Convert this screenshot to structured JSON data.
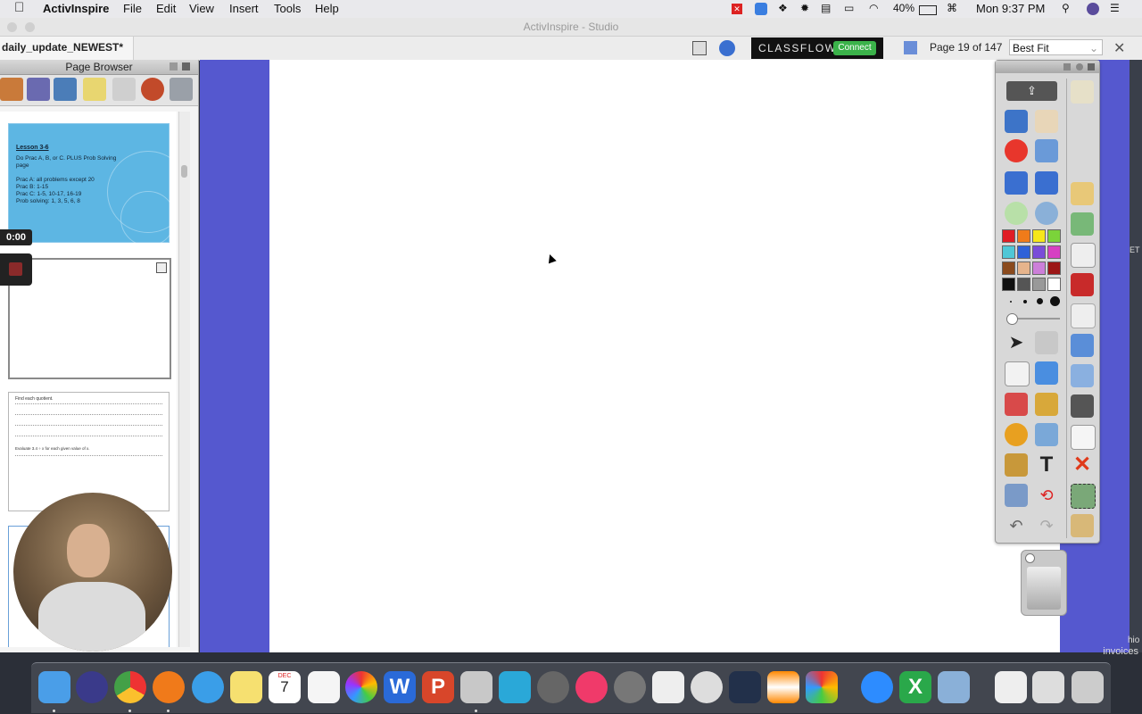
{
  "menubar": {
    "app_name": "ActivInspire",
    "menus": [
      "File",
      "Edit",
      "View",
      "Insert",
      "Tools",
      "Help"
    ],
    "battery": "40%",
    "clock": "Mon 9:37 PM"
  },
  "window": {
    "title": "ActivInspire - Studio"
  },
  "toolbar": {
    "doc_tab": "daily_update_NEWEST*",
    "classflow_label": "CLASSFLOW",
    "connect_label": "Connect",
    "page_info": "Page 19 of 147",
    "zoom_value": "Best Fit"
  },
  "page_browser": {
    "title": "Page Browser",
    "thumb1": {
      "heading": "Lesson 3-6",
      "line1": "Do Prac A, B, or C. PLUS Prob Solving",
      "line2": "page",
      "line3": "Prac A: all problems except 20",
      "line4": "Prac B: 1-15",
      "line5": "Prac C: 1-5, 10-17, 16-19",
      "line6": "Prob solving: 1, 3, 5, 6, 8"
    },
    "thumb3": {
      "heading": "Find each quotient.",
      "subheading": "Evaluate 3.4 ÷ x for each given value of x."
    }
  },
  "recording": {
    "timer": "0:00"
  },
  "desktop": {
    "invoices_label": "invoices",
    "edge_label_1": "ET",
    "edge_label_2": "hio"
  },
  "dock": {
    "calendar_month": "DEC",
    "calendar_day": "7"
  },
  "colors": {
    "canvas_border_blue": "#5558cf",
    "classflow_green": "#3bb24a",
    "thumb1_bg": "#5db6e3"
  },
  "palette": [
    "#e01c24",
    "#f07b1a",
    "#f6e71a",
    "#7bd33a",
    "#4fc7d6",
    "#2e61d8",
    "#7a4cd9",
    "#d63fc2",
    "#8a4a1d",
    "#e6b48c",
    "#cc7fd9",
    "#9c1616",
    "#111111",
    "#555555",
    "#999999",
    "#ffffff"
  ]
}
